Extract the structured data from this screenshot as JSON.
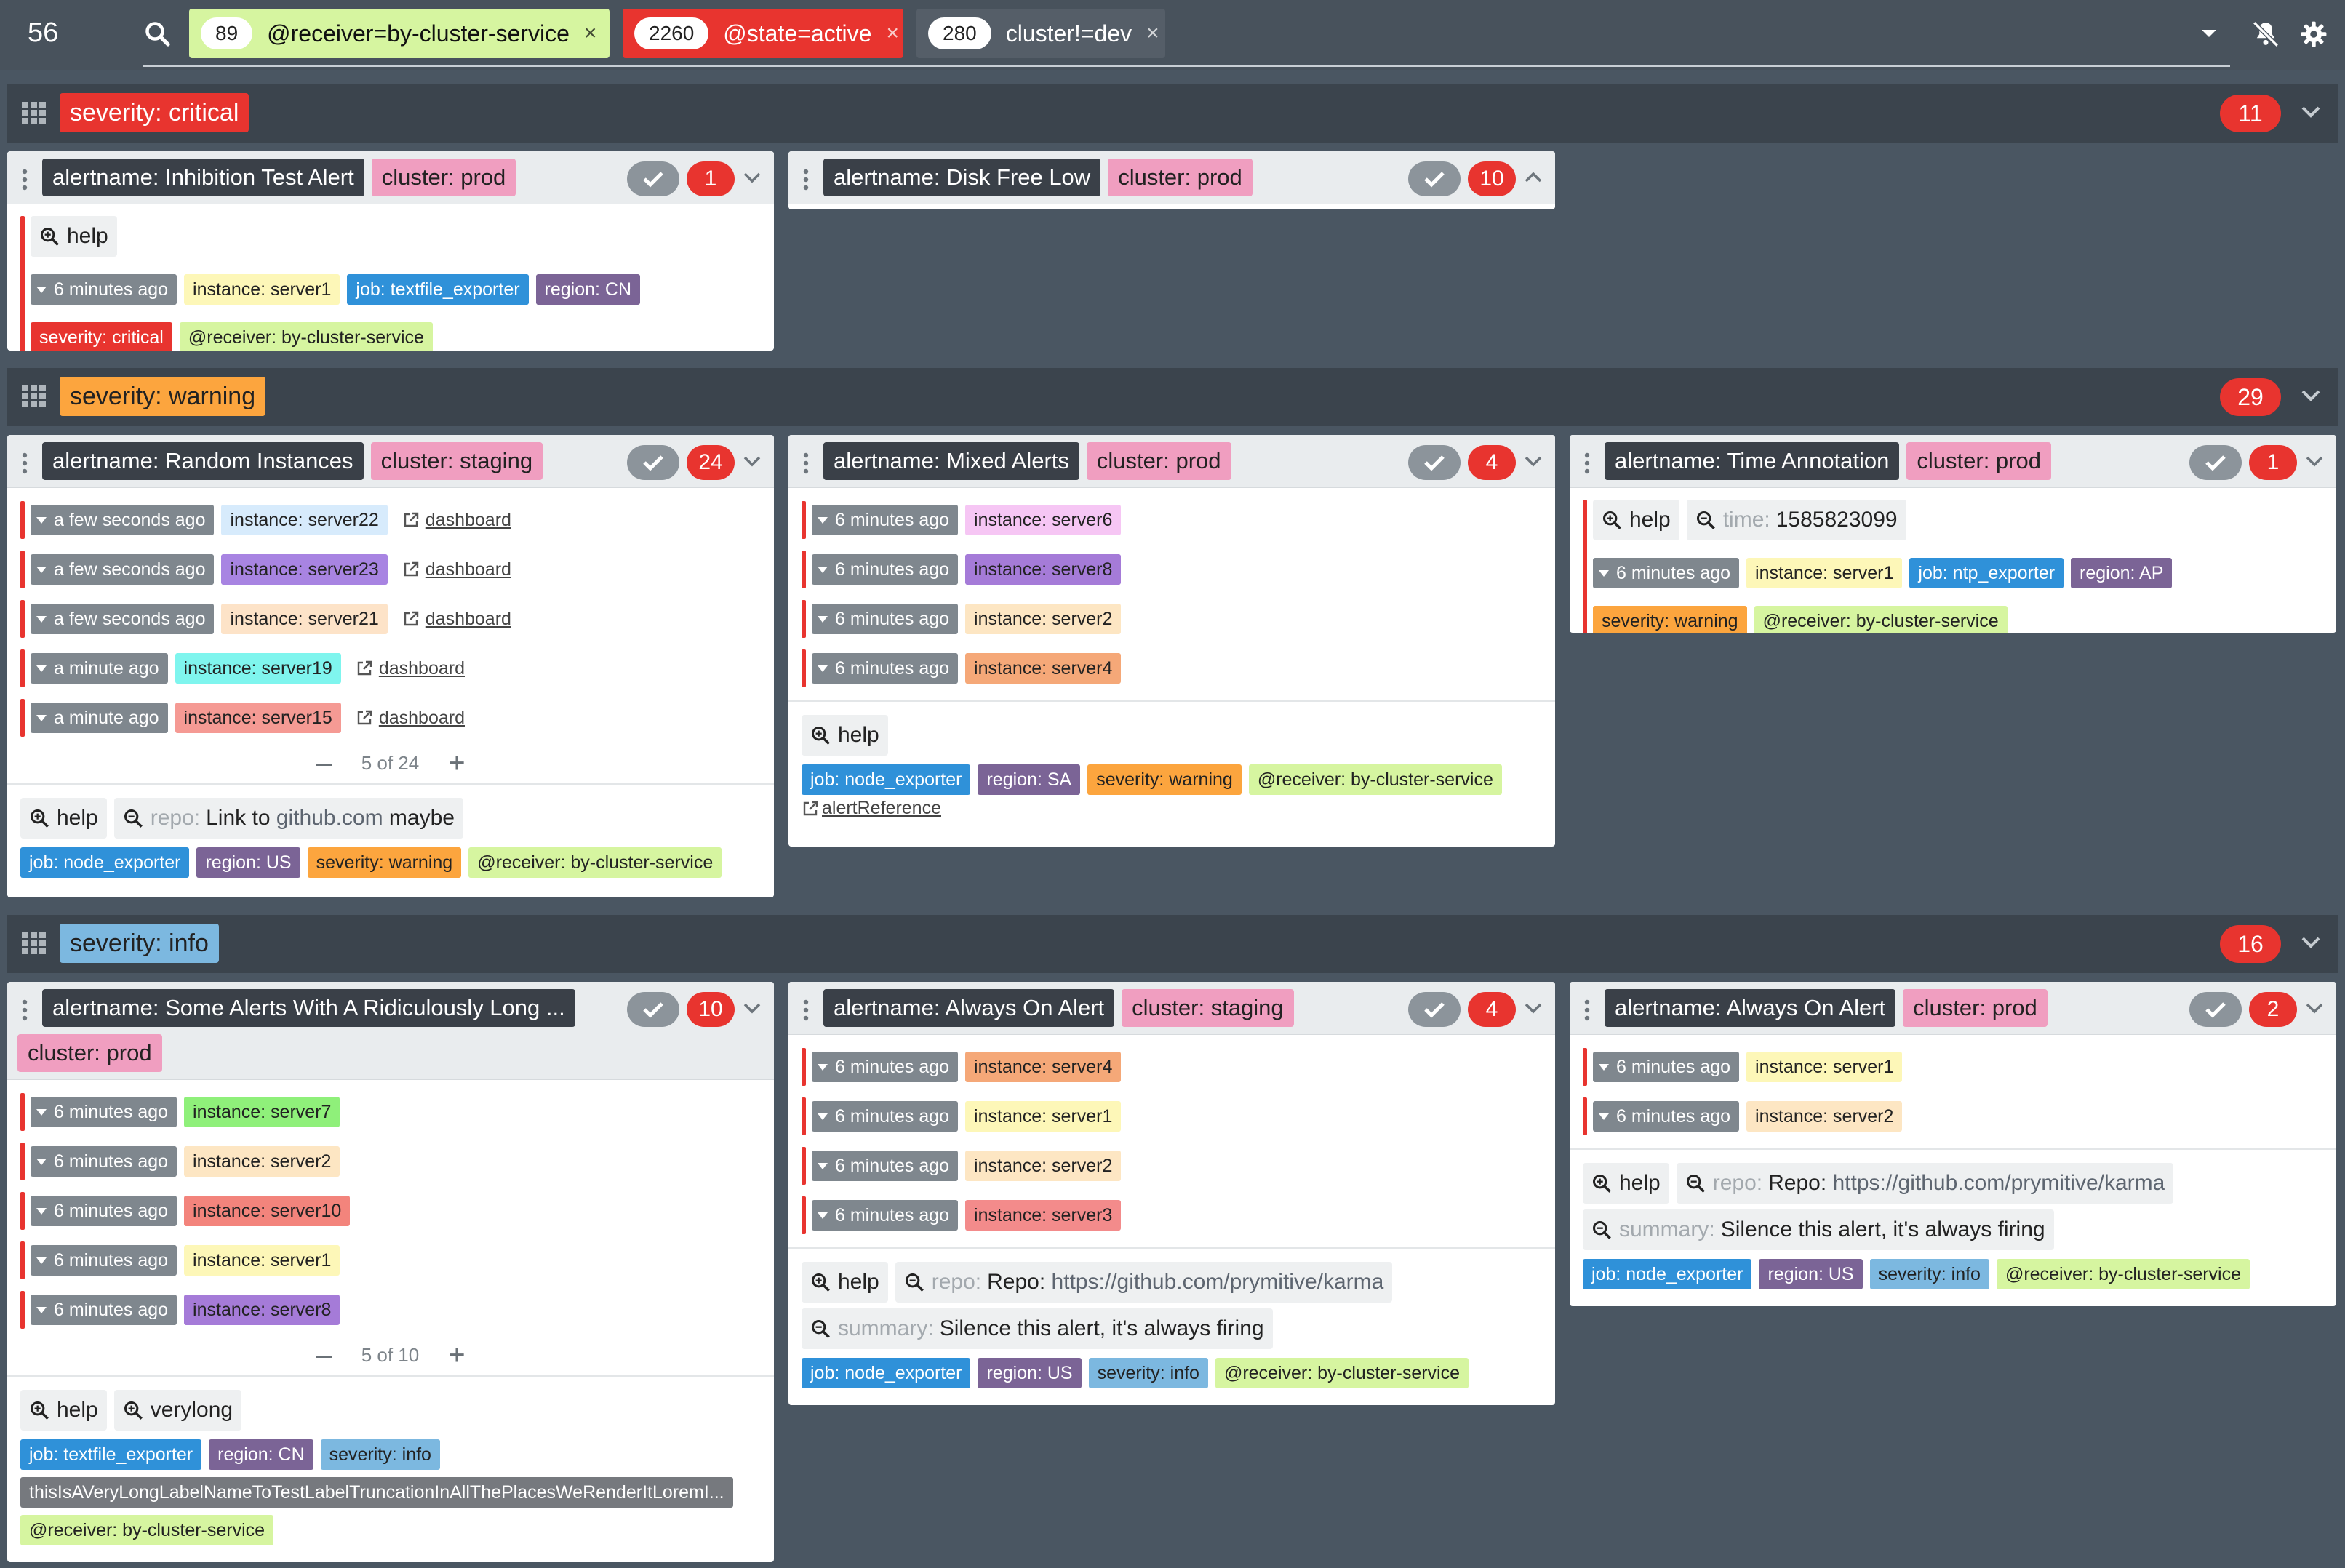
{
  "topbar": {
    "alert_count": "56",
    "filters": [
      {
        "count": "89",
        "text": "@receiver=by-cluster-service"
      },
      {
        "count": "2260",
        "text": "@state=active"
      },
      {
        "count": "280",
        "text": "cluster!=dev"
      }
    ],
    "close_glyph": "×"
  },
  "groups": [
    {
      "label": "severity: critical",
      "count": "11"
    },
    {
      "label": "severity: warning",
      "count": "29"
    },
    {
      "label": "severity: info",
      "count": "16"
    }
  ],
  "cards": {
    "inhibition": {
      "alertname": "alertname: Inhibition Test Alert",
      "cluster": "cluster: prod",
      "count": "1",
      "help": "help",
      "row": {
        "time": "6 minutes ago",
        "labels": [
          "instance: server1",
          "job: textfile_exporter",
          "region: CN",
          "severity: critical",
          "@receiver: by-cluster-service"
        ]
      }
    },
    "diskfree": {
      "alertname": "alertname: Disk Free Low",
      "cluster": "cluster: prod",
      "count": "10"
    },
    "random": {
      "alertname": "alertname: Random Instances",
      "cluster": "cluster: staging",
      "count": "24",
      "rows": [
        {
          "time": "a few seconds ago",
          "instance": "instance: server22",
          "link": "dashboard"
        },
        {
          "time": "a few seconds ago",
          "instance": "instance: server23",
          "link": "dashboard"
        },
        {
          "time": "a few seconds ago",
          "instance": "instance: server21",
          "link": "dashboard"
        },
        {
          "time": "a minute ago",
          "instance": "instance: server19",
          "link": "dashboard"
        },
        {
          "time": "a minute ago",
          "instance": "instance: server15",
          "link": "dashboard"
        }
      ],
      "pager": "5 of 24",
      "help": "help",
      "repo_key": "repo:",
      "repo_pre": "Link to ",
      "repo_link": "github.com",
      "repo_post": " maybe",
      "labels": [
        "job: node_exporter",
        "region: US",
        "severity: warning",
        "@receiver: by-cluster-service"
      ]
    },
    "mixed": {
      "alertname": "alertname: Mixed Alerts",
      "cluster": "cluster: prod",
      "count": "4",
      "rows": [
        {
          "time": "6 minutes ago",
          "instance": "instance: server6"
        },
        {
          "time": "6 minutes ago",
          "instance": "instance: server8"
        },
        {
          "time": "6 minutes ago",
          "instance": "instance: server2"
        },
        {
          "time": "6 minutes ago",
          "instance": "instance: server4"
        }
      ],
      "help": "help",
      "labels": [
        "job: node_exporter",
        "region: SA",
        "severity: warning",
        "@receiver: by-cluster-service"
      ],
      "link": "alertReference"
    },
    "timeann": {
      "alertname": "alertname: Time Annotation",
      "cluster": "cluster: prod",
      "count": "1",
      "help": "help",
      "time_key": "time:",
      "time_val": "1585823099",
      "row": {
        "time": "6 minutes ago",
        "labels": [
          "instance: server1",
          "job: ntp_exporter",
          "region: AP",
          "severity: warning",
          "@receiver: by-cluster-service"
        ]
      }
    },
    "longname": {
      "alertname": "alertname: Some Alerts With A Ridiculously Long ...",
      "cluster": "cluster: prod",
      "count": "10",
      "rows": [
        {
          "time": "6 minutes ago",
          "instance": "instance: server7"
        },
        {
          "time": "6 minutes ago",
          "instance": "instance: server2"
        },
        {
          "time": "6 minutes ago",
          "instance": "instance: server10"
        },
        {
          "time": "6 minutes ago",
          "instance": "instance: server1"
        },
        {
          "time": "6 minutes ago",
          "instance": "instance: server8"
        }
      ],
      "pager": "5 of 10",
      "help": "help",
      "verylong": "verylong",
      "labels": [
        "job: textfile_exporter",
        "region: CN",
        "severity: info"
      ],
      "long_label": "thisIsAVeryLongLabelNameToTestLabelTruncationInAllThePlacesWeRenderItLoremI...",
      "receiver": "@receiver: by-cluster-service"
    },
    "alwayson_staging": {
      "alertname": "alertname: Always On Alert",
      "cluster": "cluster: staging",
      "count": "4",
      "rows": [
        {
          "time": "6 minutes ago",
          "instance": "instance: server4"
        },
        {
          "time": "6 minutes ago",
          "instance": "instance: server1"
        },
        {
          "time": "6 minutes ago",
          "instance": "instance: server2"
        },
        {
          "time": "6 minutes ago",
          "instance": "instance: server3"
        }
      ],
      "help": "help",
      "repo_key": "repo:",
      "repo_pre": "Repo: ",
      "repo_link": "https://github.com/prymitive/karma",
      "summary_key": "summary:",
      "summary_val": "Silence this alert, it's always firing",
      "labels": [
        "job: node_exporter",
        "region: US",
        "severity: info",
        "@receiver: by-cluster-service"
      ]
    },
    "alwayson_prod": {
      "alertname": "alertname: Always On Alert",
      "cluster": "cluster: prod",
      "count": "2",
      "rows": [
        {
          "time": "6 minutes ago",
          "instance": "instance: server1"
        },
        {
          "time": "6 minutes ago",
          "instance": "instance: server2"
        }
      ],
      "help": "help",
      "repo_key": "repo:",
      "repo_pre": "Repo: ",
      "repo_link": "https://github.com/prymitive/karma",
      "summary_key": "summary:",
      "summary_val": "Silence this alert, it's always firing",
      "labels": [
        "job: node_exporter",
        "region: US",
        "severity: info",
        "@receiver: by-cluster-service"
      ]
    }
  },
  "colors": {
    "critical": "#e8342f",
    "warning": "#fca53e",
    "info": "#7cb8e0",
    "receiver": "#d6f5a0",
    "job": "#2f91d9",
    "region": "#7b6496",
    "instances": {
      "server1": "#fdf7b8",
      "server2": "#fde6c3",
      "server3": "#f38b8b",
      "server4": "#f5a878",
      "server6": "#f6c6f4",
      "server7": "#8ff07a",
      "server8": "#a57bd8",
      "server10": "#f3847c",
      "server15": "#f59a94",
      "server19": "#7ff5ee",
      "server21": "#fde3c8",
      "server22": "#d7ebfc",
      "server23": "#a884e2"
    }
  }
}
